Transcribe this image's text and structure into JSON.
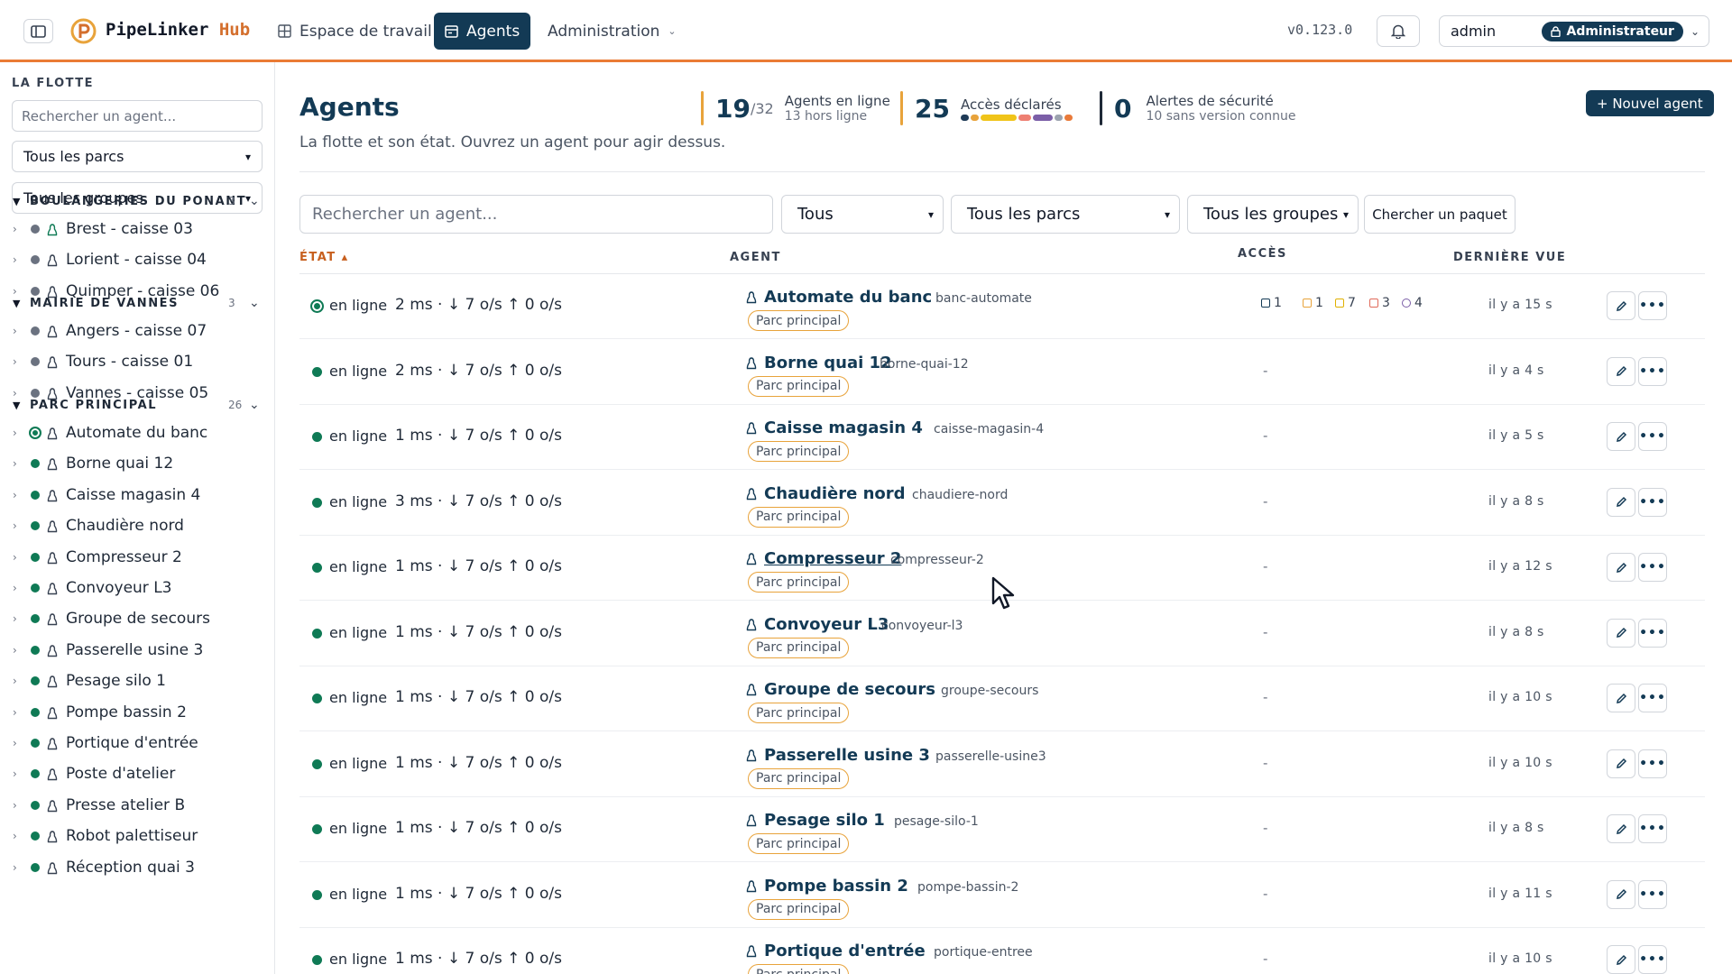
{
  "topbar": {
    "brand_main": "PipeLinker",
    "brand_suffix": "Hub",
    "nav": {
      "workspace": "Espace de travail",
      "agents": "Agents",
      "admin": "Administration"
    },
    "version": "v0.123.0",
    "user": "admin",
    "role": "Administrateur"
  },
  "sidebar": {
    "title": "LA FLOTTE",
    "search_placeholder": "Rechercher un agent...",
    "park_filter": "Tous les parcs",
    "group_filter": "Tous les groupes",
    "groups": [
      {
        "name": "BOULANGERIES DU PONANT",
        "count": "3",
        "items": [
          "Brest - caisse 03",
          "Lorient - caisse 04",
          "Quimper - caisse 06"
        ]
      },
      {
        "name": "MAIRIE DE VANNES",
        "count": "3",
        "items": [
          "Angers - caisse 07",
          "Tours - caisse 01",
          "Vannes - caisse 05"
        ]
      },
      {
        "name": "PARC PRINCIPAL",
        "count": "26",
        "items": [
          "Automate du banc",
          "Borne quai 12",
          "Caisse magasin 4",
          "Chaudière nord",
          "Compresseur 2",
          "Convoyeur L3",
          "Groupe de secours",
          "Passerelle usine 3",
          "Pesage silo 1",
          "Pompe bassin 2",
          "Portique d'entrée",
          "Poste d'atelier",
          "Presse atelier B",
          "Robot palettiseur",
          "Réception quai 3"
        ]
      }
    ]
  },
  "main": {
    "title": "Agents",
    "subtitle": "La flotte et son état. Ouvrez un agent pour agir dessus.",
    "stats": {
      "online_value": "19",
      "online_total": "/32",
      "online_label": "Agents en ligne",
      "offline_label": "13 hors ligne",
      "access_value": "25",
      "access_label": "Accès déclarés",
      "alerts_value": "0",
      "alerts_label": "Alertes de sécurité",
      "alerts_sub": "10 sans version connue"
    },
    "access_mix_colors": [
      "#1f3b57",
      "#e8a33b",
      "#f0c419",
      "#ee7f72",
      "#7b5ea7",
      "#9ca3af",
      "#e97a3a"
    ],
    "new_agent_label": "+ Nouvel agent",
    "filters": {
      "search_placeholder": "Rechercher un agent...",
      "state": "Tous",
      "park": "Tous les parcs",
      "group": "Tous les groupes",
      "package_btn": "Chercher un paquet"
    },
    "columns": {
      "state": "ÉTAT ▴",
      "agent": "AGENT",
      "access": "ACCÈS",
      "last_seen": "DERNIÈRE VUE"
    },
    "rows": [
      {
        "state": "en ligne",
        "metrics": "2 ms · ↓ 7 o/s ↑ 0 o/s",
        "name": "Automate du banc",
        "id": "banc-automate",
        "park": "Parc principal",
        "access": "",
        "seen": "il y a 15 s"
      },
      {
        "state": "en ligne",
        "metrics": "2 ms · ↓ 7 o/s ↑ 0 o/s",
        "name": "Borne quai 12",
        "id": "borne-quai-12",
        "park": "Parc principal",
        "access": "-",
        "seen": "il y a 4 s"
      },
      {
        "state": "en ligne",
        "metrics": "1 ms · ↓ 7 o/s ↑ 0 o/s",
        "name": "Caisse magasin 4",
        "id": "caisse-magasin-4",
        "park": "Parc principal",
        "access": "-",
        "seen": "il y a 5 s"
      },
      {
        "state": "en ligne",
        "metrics": "3 ms · ↓ 7 o/s ↑ 0 o/s",
        "name": "Chaudière nord",
        "id": "chaudiere-nord",
        "park": "Parc principal",
        "access": "-",
        "seen": "il y a 8 s"
      },
      {
        "state": "en ligne",
        "metrics": "1 ms · ↓ 7 o/s ↑ 0 o/s",
        "name": "Compresseur 2",
        "id": "compresseur-2",
        "park": "Parc principal",
        "access": "-",
        "seen": "il y a 12 s"
      },
      {
        "state": "en ligne",
        "metrics": "1 ms · ↓ 7 o/s ↑ 0 o/s",
        "name": "Convoyeur L3",
        "id": "convoyeur-l3",
        "park": "Parc principal",
        "access": "-",
        "seen": "il y a 8 s"
      },
      {
        "state": "en ligne",
        "metrics": "1 ms · ↓ 7 o/s ↑ 0 o/s",
        "name": "Groupe de secours",
        "id": "groupe-secours",
        "park": "Parc principal",
        "access": "-",
        "seen": "il y a 10 s"
      },
      {
        "state": "en ligne",
        "metrics": "1 ms · ↓ 7 o/s ↑ 0 o/s",
        "name": "Passerelle usine 3",
        "id": "passerelle-usine3",
        "park": "Parc principal",
        "access": "-",
        "seen": "il y a 10 s"
      },
      {
        "state": "en ligne",
        "metrics": "1 ms · ↓ 7 o/s ↑ 0 o/s",
        "name": "Pesage silo 1",
        "id": "pesage-silo-1",
        "park": "Parc principal",
        "access": "-",
        "seen": "il y a 8 s"
      },
      {
        "state": "en ligne",
        "metrics": "1 ms · ↓ 7 o/s ↑ 0 o/s",
        "name": "Pompe bassin 2",
        "id": "pompe-bassin-2",
        "park": "Parc principal",
        "access": "-",
        "seen": "il y a 11 s"
      },
      {
        "state": "en ligne",
        "metrics": "1 ms · ↓ 7 o/s ↑ 0 o/s",
        "name": "Portique d'entrée",
        "id": "portique-entree",
        "park": "Parc principal",
        "access": "-",
        "seen": "il y a 10 s"
      }
    ],
    "first_row_access": [
      {
        "icon": "screen-icon",
        "count": "1",
        "color": "#133a55"
      },
      {
        "icon": "transfer-icon",
        "count": "1",
        "color": "#e8a33b"
      },
      {
        "icon": "terminal-icon",
        "count": "7",
        "color": "#e0b000"
      },
      {
        "icon": "chat-icon",
        "count": "3",
        "color": "#e06a5a"
      },
      {
        "icon": "globe-icon",
        "count": "4",
        "color": "#7b5ea7"
      }
    ]
  }
}
